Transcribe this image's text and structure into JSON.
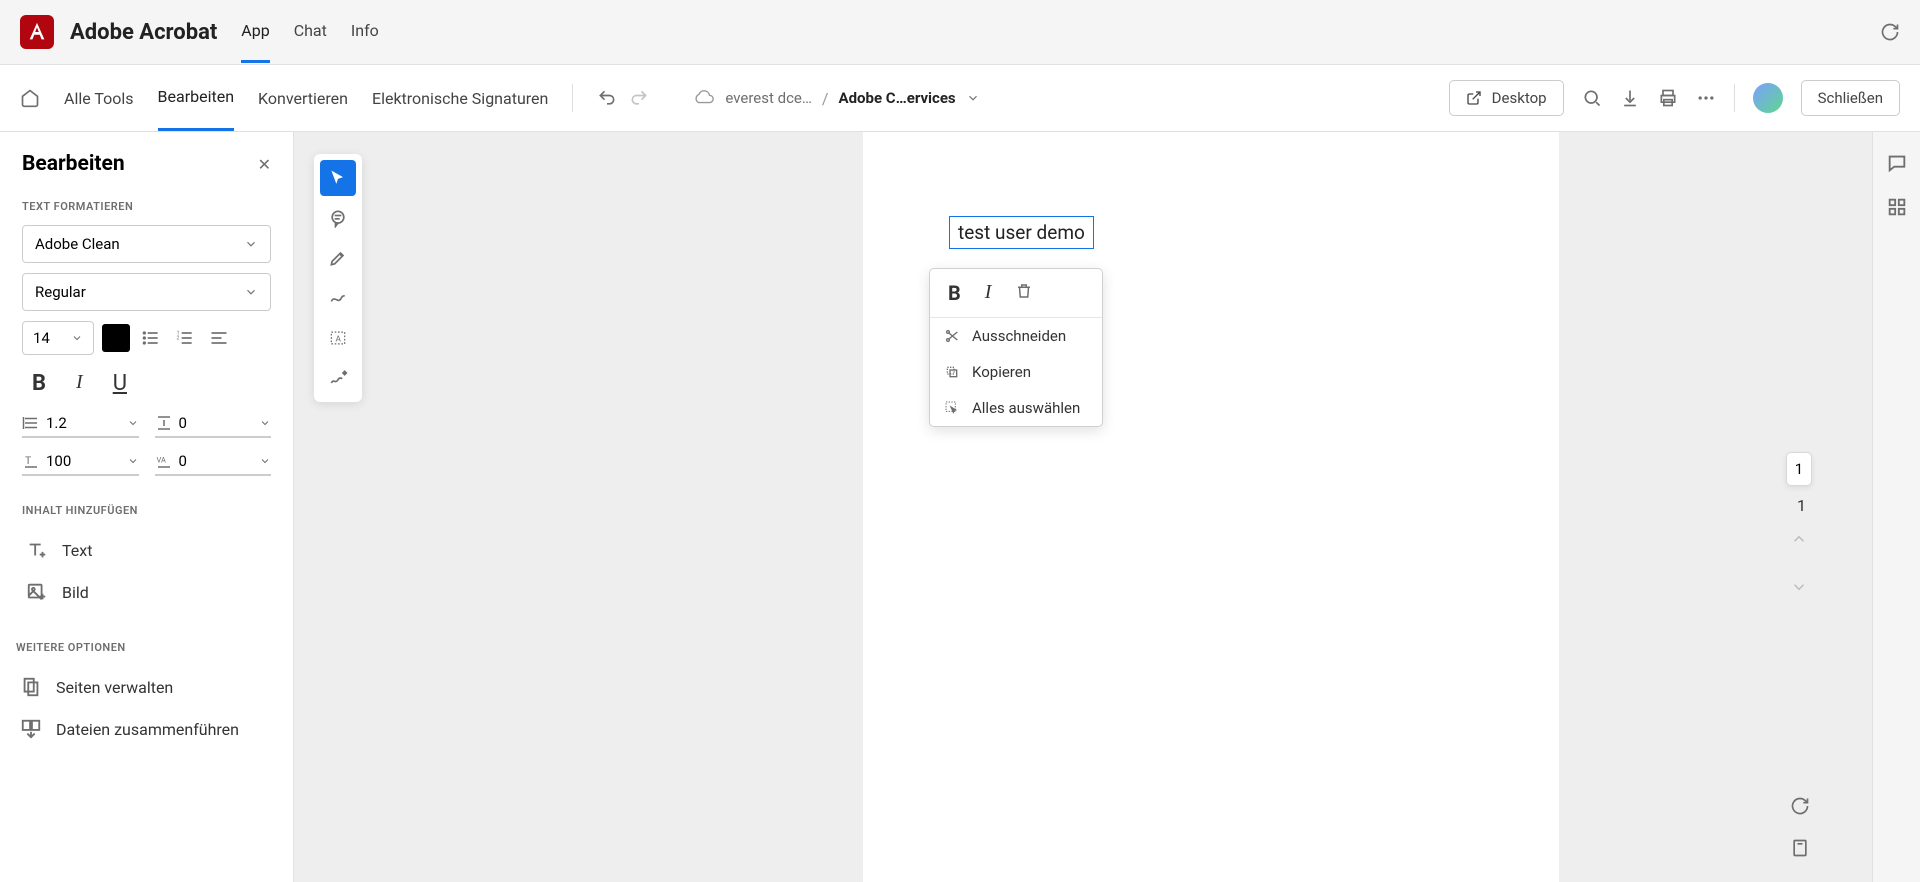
{
  "topbar": {
    "app_title": "Adobe Acrobat",
    "tabs": [
      "App",
      "Chat",
      "Info"
    ]
  },
  "toolbar": {
    "tabs": [
      "Alle Tools",
      "Bearbeiten",
      "Konvertieren",
      "Elektronische Signaturen"
    ],
    "breadcrumb_folder": "everest dce…",
    "breadcrumb_file": "Adobe C…ervices",
    "desktop_label": "Desktop",
    "close_label": "Schließen"
  },
  "sidebar": {
    "title": "Bearbeiten",
    "section_text": "TEXT FORMATIEREN",
    "font_family": "Adobe Clean",
    "font_style": "Regular",
    "font_size": "14",
    "line_height": "1.2",
    "line_spacing": "0",
    "horiz_scale": "100",
    "tracking": "0",
    "section_add": "INHALT HINZUFÜGEN",
    "add_text": "Text",
    "add_image": "Bild",
    "section_more": "WEITERE OPTIONEN",
    "manage_pages": "Seiten verwalten",
    "merge_files": "Dateien zusammenführen"
  },
  "document": {
    "text_content": "test user demo"
  },
  "context_menu": {
    "cut": "Ausschneiden",
    "copy": "Kopieren",
    "select_all": "Alles auswählen"
  },
  "right": {
    "page_current": "1",
    "page_total": "1"
  }
}
